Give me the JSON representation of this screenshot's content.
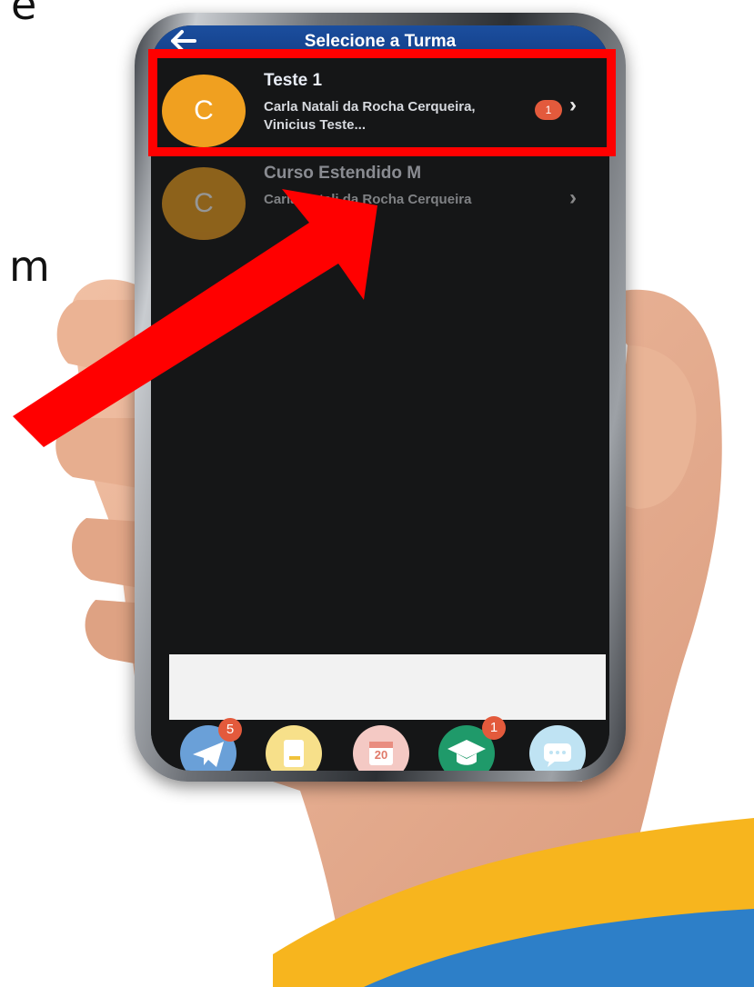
{
  "background_text": {
    "top_right_char": "e",
    "middle_char": "m"
  },
  "header": {
    "title": "Selecione a Turma",
    "back_icon": "arrow-left-icon",
    "color": "#1b4e9e"
  },
  "classes": [
    {
      "avatar_letter": "C",
      "title": "Teste 1",
      "subtitle": "Carla Natali da Rocha Cerqueira, Vinicius Teste...",
      "badge": "1"
    },
    {
      "avatar_letter": "C",
      "title": "Curso Estendido M",
      "subtitle": "Carla Natali da Rocha Cerqueira"
    }
  ],
  "tabbar": {
    "items": [
      {
        "icon": "send-icon",
        "color": "#6aa0d8",
        "badge": "5"
      },
      {
        "icon": "notebook-icon",
        "color": "#f7e08a"
      },
      {
        "icon": "calendar-icon",
        "color": "#f4c9c4",
        "label": "20"
      },
      {
        "icon": "graduation-cap-icon",
        "color": "#1f9a6a",
        "badge": "1"
      },
      {
        "icon": "chat-icon",
        "color": "#bfe3f3"
      }
    ]
  },
  "colors": {
    "avatar": "#f0a020",
    "badge": "#e35a3c",
    "highlight": "#ff0000",
    "screen_bg": "#151617"
  }
}
